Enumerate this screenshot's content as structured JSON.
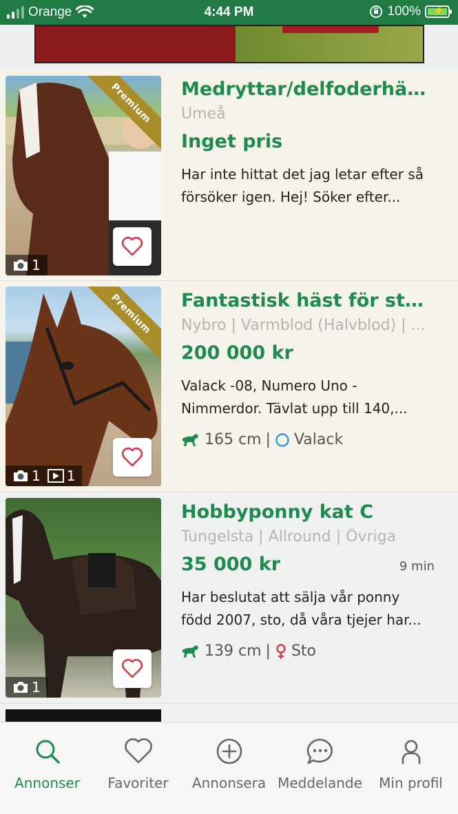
{
  "status_bar": {
    "carrier": "Orange",
    "time": "4:44 PM",
    "battery": "100%"
  },
  "listings": [
    {
      "title": "Medryttar/delfoderhäst...",
      "location": "Umeå",
      "price": "Inget pris",
      "time": "",
      "premium": "Premium",
      "description_lines": [
        "Har inte hittat det jag letar efter så",
        "försöker igen.  Hej!  Söker efter..."
      ],
      "photo_count": "1",
      "video_count": ""
    },
    {
      "title": "Fantastisk häst för större...",
      "location": "Nybro | Varmblod (Halvblod) | ...",
      "price": "200 000 kr",
      "time": "",
      "premium": "Premium",
      "description_lines": [
        "Valack -08, Numero Uno -",
        "Nimmerdor. Tävlat upp till 140,..."
      ],
      "photo_count": "1",
      "video_count": "1",
      "height": "165 cm",
      "gender": "Valack"
    },
    {
      "title": "Hobbyponny kat C",
      "location": "Tungelsta | Allround | Övriga",
      "price": "35 000 kr",
      "time": "9 min",
      "premium": "",
      "description_lines": [
        "Har beslutat att sälja vår ponny",
        "född 2007, sto, då våra tjejer har..."
      ],
      "photo_count": "1",
      "video_count": "",
      "height": "139 cm",
      "gender": "Sto"
    }
  ],
  "separator": "|",
  "tabs": [
    {
      "label": "Annonser",
      "icon": "search-icon",
      "active": true
    },
    {
      "label": "Favoriter",
      "icon": "heart-icon",
      "active": false
    },
    {
      "label": "Annonsera",
      "icon": "plus-circle-icon",
      "active": false
    },
    {
      "label": "Meddelande",
      "icon": "chat-icon",
      "active": false
    },
    {
      "label": "Min profil",
      "icon": "user-icon",
      "active": false
    }
  ],
  "colors": {
    "brand_green": "#1f8a4f",
    "status_green": "#1f7a44",
    "premium_gold": "#a98d2b",
    "heart_red": "#d23a4a"
  }
}
